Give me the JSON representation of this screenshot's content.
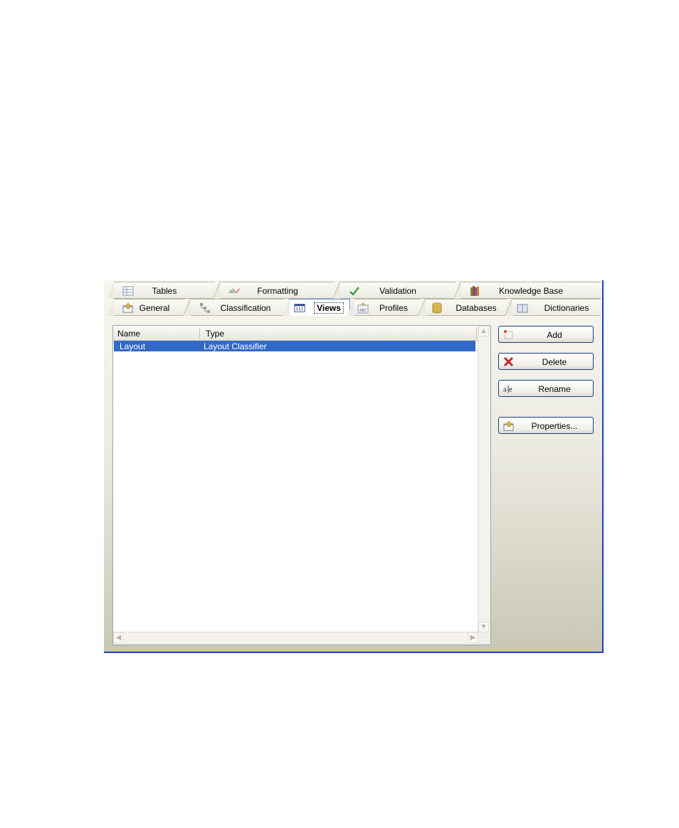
{
  "tabs": {
    "top_row": [
      {
        "label": "Tables",
        "icon": "table-icon"
      },
      {
        "label": "Formatting",
        "icon": "spelling-icon"
      },
      {
        "label": "Validation",
        "icon": "checkmark-icon"
      },
      {
        "label": "Knowledge Base",
        "icon": "books-icon"
      }
    ],
    "bottom_row": [
      {
        "label": "General",
        "icon": "properties-icon"
      },
      {
        "label": "Classification",
        "icon": "hierarchy-icon"
      },
      {
        "label": "Views",
        "icon": "view-icon",
        "active": true
      },
      {
        "label": "Profiles",
        "icon": "profile-icon"
      },
      {
        "label": "Databases",
        "icon": "database-icon"
      },
      {
        "label": "Dictionaries",
        "icon": "dictionary-icon"
      }
    ]
  },
  "list": {
    "columns": [
      "Name",
      "Type"
    ],
    "rows": [
      {
        "name": "Layout",
        "type": "Layout Classifier",
        "selected": true
      }
    ]
  },
  "buttons": {
    "add": "Add",
    "delete": "Delete",
    "rename": "Rename",
    "properties": "Properties..."
  },
  "colors": {
    "selection": "#3169c6",
    "window_border": "#1f3fb5",
    "active_tab_border": "#6b88c4"
  }
}
